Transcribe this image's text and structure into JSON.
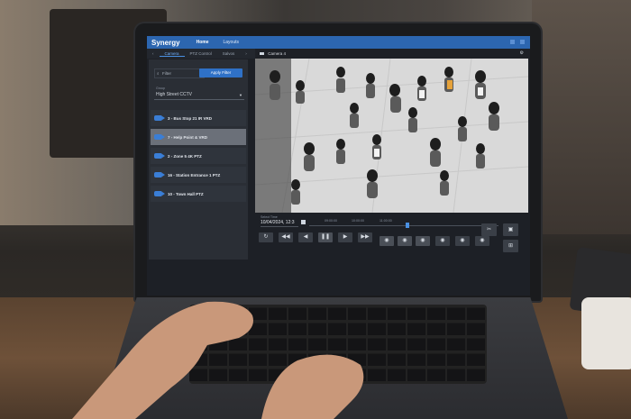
{
  "app": {
    "logo": "Synergy",
    "nav": [
      "Home",
      "Layouts"
    ]
  },
  "sidebar": {
    "tabs": [
      "Camera",
      "PTZ Control",
      "Salvos"
    ],
    "filter_placeholder": "Filter",
    "apply_label": "Apply Filter",
    "group_label": "Group",
    "group_value": "High Street CCTV",
    "cameras": [
      {
        "label": "3 - Bus Stop 21 IR VRD",
        "selected": false
      },
      {
        "label": "7 - Help Point & VRD",
        "selected": true
      },
      {
        "label": "2 - Zone 5 4K PTZ",
        "selected": false
      },
      {
        "label": "16 - Station Entrance 1 PTZ",
        "selected": false
      },
      {
        "label": "10 - Town Hall PTZ",
        "selected": false
      }
    ]
  },
  "video": {
    "title": "Camera 4"
  },
  "timeline": {
    "select_time_label": "Select Time",
    "select_time_value": "10/04/2024, 12:3",
    "ticks": [
      "09:00:00",
      "10:00:00",
      "11:00:00"
    ]
  },
  "icons": {
    "scissors": "scissors-icon",
    "save": "save-icon",
    "layout": "layout-grid-icon",
    "refresh": "refresh-icon"
  },
  "colors": {
    "accent": "#2c66b0",
    "button_primary": "#2f71c7",
    "panel": "#2a2e35"
  }
}
